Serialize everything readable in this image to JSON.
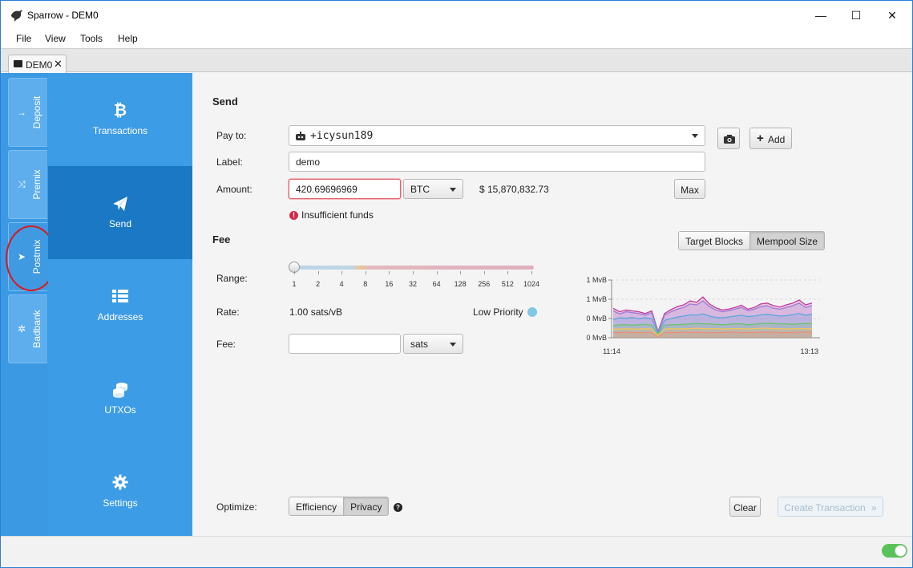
{
  "window": {
    "title": "Sparrow - DEM0",
    "controls": {
      "minimize": "—",
      "maximize": "☐",
      "close": "✕"
    }
  },
  "menu": [
    "File",
    "View",
    "Tools",
    "Help"
  ],
  "doc_tab": {
    "label": "DEM0",
    "close": "✕"
  },
  "left_tabs": [
    {
      "label": "Deposit",
      "icon": "arrow-right-icon",
      "glyph": "→"
    },
    {
      "label": "Premix",
      "icon": "shuffle-icon",
      "glyph": "⤨"
    },
    {
      "label": "Postmix",
      "icon": "send-icon",
      "glyph": "➤"
    },
    {
      "label": "Badbank",
      "icon": "bug-icon",
      "glyph": "✲"
    }
  ],
  "nav": [
    {
      "label": "Transactions",
      "icon": "bitcoin-icon"
    },
    {
      "label": "Send",
      "icon": "paper-plane-icon"
    },
    {
      "label": "Addresses",
      "icon": "list-icon"
    },
    {
      "label": "UTXOs",
      "icon": "coins-icon"
    },
    {
      "label": "Settings",
      "icon": "gear-icon"
    }
  ],
  "send": {
    "section_title": "Send",
    "pay_to_label": "Pay to:",
    "pay_to_value": "+icysun189",
    "label_label": "Label:",
    "label_value": "demo",
    "amount_label": "Amount:",
    "amount_value": "420.69696969",
    "unit": "BTC",
    "fiat": "$ 15,870,832.73",
    "max_label": "Max",
    "add_label": "Add",
    "error": "Insufficient funds"
  },
  "fee": {
    "section_title": "Fee",
    "toggle": {
      "options": [
        "Target Blocks",
        "Mempool Size"
      ],
      "selected": "Mempool Size"
    },
    "range_label": "Range:",
    "range_ticks": [
      "1",
      "2",
      "4",
      "8",
      "16",
      "32",
      "64",
      "128",
      "256",
      "512",
      "1024"
    ],
    "range_value": 1,
    "rate_label": "Rate:",
    "rate_value": "1.00 sats/vB",
    "priority": "Low Priority",
    "fee_label": "Fee:",
    "fee_value": "",
    "fee_unit": "sats"
  },
  "chart_data": {
    "type": "area",
    "title": "",
    "xlabel": "",
    "ylabel": "",
    "y_ticks": [
      "1 MvB",
      "1 MvB",
      "0 MvB",
      "0 MvB"
    ],
    "x_ticks": [
      "11:14",
      "13:13"
    ],
    "grid": true,
    "series": [
      {
        "color": "#f08c7a",
        "values": [
          0.12,
          0.12,
          0.13,
          0.12,
          0.12,
          0.12,
          0.12,
          0.02,
          0.12,
          0.12,
          0.12,
          0.13,
          0.12,
          0.13,
          0.12,
          0.12,
          0.12,
          0.12,
          0.13,
          0.13,
          0.12,
          0.12,
          0.12,
          0.13,
          0.13,
          0.13,
          0.12,
          0.12,
          0.12,
          0.13,
          0.13,
          0.13
        ]
      },
      {
        "color": "#f2c45c",
        "values": [
          0.2,
          0.2,
          0.21,
          0.2,
          0.2,
          0.21,
          0.2,
          0.05,
          0.2,
          0.21,
          0.2,
          0.21,
          0.21,
          0.22,
          0.21,
          0.21,
          0.21,
          0.2,
          0.21,
          0.21,
          0.21,
          0.2,
          0.21,
          0.22,
          0.22,
          0.21,
          0.21,
          0.2,
          0.21,
          0.21,
          0.21,
          0.21
        ]
      },
      {
        "color": "#6cc474",
        "values": [
          0.28,
          0.3,
          0.3,
          0.29,
          0.3,
          0.31,
          0.29,
          0.08,
          0.29,
          0.3,
          0.3,
          0.31,
          0.32,
          0.33,
          0.32,
          0.32,
          0.31,
          0.3,
          0.31,
          0.32,
          0.32,
          0.3,
          0.31,
          0.33,
          0.33,
          0.33,
          0.32,
          0.32,
          0.31,
          0.32,
          0.33,
          0.33
        ]
      },
      {
        "color": "#5aa5de",
        "values": [
          0.42,
          0.46,
          0.45,
          0.47,
          0.44,
          0.46,
          0.44,
          0.1,
          0.4,
          0.44,
          0.48,
          0.5,
          0.53,
          0.52,
          0.55,
          0.5,
          0.47,
          0.46,
          0.48,
          0.5,
          0.52,
          0.49,
          0.5,
          0.53,
          0.54,
          0.52,
          0.5,
          0.51,
          0.53,
          0.56,
          0.52,
          0.54
        ]
      },
      {
        "color": "#9d7ad8",
        "values": [
          0.62,
          0.55,
          0.6,
          0.58,
          0.56,
          0.52,
          0.58,
          0.12,
          0.52,
          0.6,
          0.66,
          0.7,
          0.78,
          0.76,
          0.85,
          0.72,
          0.64,
          0.6,
          0.62,
          0.66,
          0.7,
          0.62,
          0.66,
          0.72,
          0.74,
          0.68,
          0.66,
          0.7,
          0.74,
          0.8,
          0.7,
          0.74
        ]
      },
      {
        "color": "#c2379b",
        "values": [
          0.68,
          0.6,
          0.64,
          0.62,
          0.6,
          0.56,
          0.62,
          0.14,
          0.56,
          0.65,
          0.72,
          0.76,
          0.85,
          0.82,
          0.94,
          0.78,
          0.69,
          0.64,
          0.66,
          0.7,
          0.75,
          0.66,
          0.7,
          0.78,
          0.8,
          0.74,
          0.71,
          0.76,
          0.8,
          0.87,
          0.76,
          0.8
        ]
      }
    ]
  },
  "optimize": {
    "label": "Optimize:",
    "options": [
      "Efficiency",
      "Privacy"
    ],
    "selected": "Privacy",
    "help": "?"
  },
  "actions": {
    "clear": "Clear",
    "create": "Create Transaction",
    "create_arrow": "»"
  },
  "colors": {
    "accent": "#3d9ce6",
    "nav_active": "#1b78c4",
    "error": "#d42a4a",
    "priority_dot": "#7ec8e6",
    "toggle_on": "#5ac25a"
  }
}
